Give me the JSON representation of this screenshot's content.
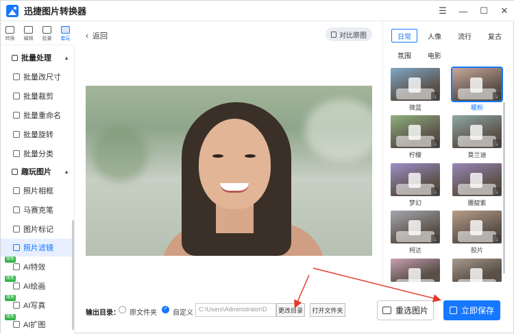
{
  "app": {
    "title": "迅捷图片转换器"
  },
  "window_controls": {
    "menu": "☰",
    "minimize": "—",
    "maximize": "☐",
    "close": "✕"
  },
  "rail": [
    {
      "label": "转换",
      "icon": "convert-icon"
    },
    {
      "label": "编辑",
      "icon": "edit-icon"
    },
    {
      "label": "批量",
      "icon": "batch-icon"
    },
    {
      "label": "套玩",
      "icon": "fun-icon",
      "active": true
    }
  ],
  "sidebar": {
    "section1": "批量处理",
    "items1": [
      "批量改尺寸",
      "批量裁剪",
      "批量重命名",
      "批量旋转",
      "批量分类"
    ],
    "section2": "趣玩图片",
    "items2": [
      "照片相框",
      "马赛克笔",
      "图片标记",
      "照片滤镜"
    ],
    "ai_items": [
      "AI特效",
      "AI绘画",
      "AI写真",
      "AI扩图"
    ],
    "ai_badge": "限免"
  },
  "main": {
    "back_label": "返回",
    "compare_label": "对比原图"
  },
  "output": {
    "label": "输出目录：",
    "option_original": "原文件夹",
    "option_custom": "自定义",
    "path": "C:\\Users\\Administrator\\D",
    "change_dir": "更改目录",
    "open_folder": "打开文件夹",
    "reselect": "重选图片",
    "save": "立即保存"
  },
  "filters": {
    "tabs": [
      "日常",
      "人像",
      "流行",
      "复古",
      "氛围",
      "电影"
    ],
    "active_tab": "日常",
    "items": [
      {
        "name": "微蓝",
        "tint": "#7ea7c6"
      },
      {
        "name": "暖粉",
        "tint": "#c9a79b",
        "selected": true
      },
      {
        "name": "柠檬",
        "tint": "#8fb07e"
      },
      {
        "name": "莫兰迪",
        "tint": "#8fa8a4"
      },
      {
        "name": "梦幻",
        "tint": "#9d8fc9"
      },
      {
        "name": "腰靛紫",
        "tint": "#9a86b8"
      },
      {
        "name": "柯达",
        "tint": "#a5a7b0"
      },
      {
        "name": "胶片",
        "tint": "#b89d8a"
      },
      {
        "name": "",
        "tint": "#c89fb4"
      },
      {
        "name": "",
        "tint": "#a99a8c"
      }
    ]
  },
  "colors": {
    "accent": "#1677ff",
    "badge": "#34b34a",
    "arrow": "#e53a2c"
  }
}
